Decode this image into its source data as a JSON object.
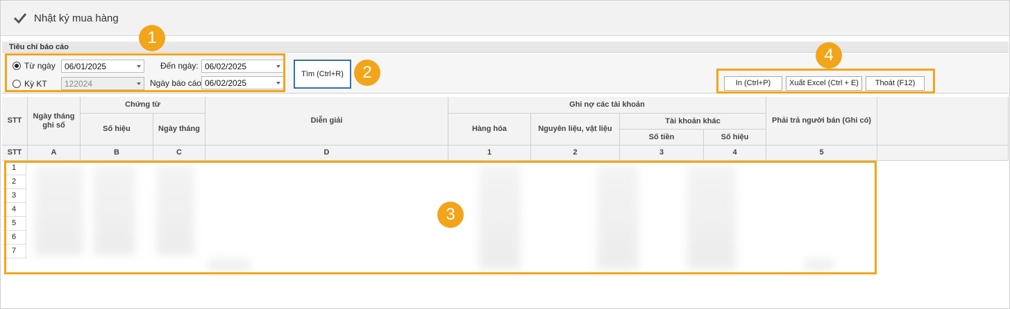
{
  "window": {
    "title": "Nhật ký mua hàng"
  },
  "criteria": {
    "section_title": "Tiêu chí báo cáo",
    "from_date": {
      "label": "Từ ngày",
      "value": "06/01/2025",
      "selected": true
    },
    "period": {
      "label": "Kỳ KT",
      "value": "122024",
      "selected": false
    },
    "to_date": {
      "label": "Đến ngày:",
      "value": "06/02/2025"
    },
    "report_date": {
      "label": "Ngày báo cáo:",
      "value": "06/02/2025"
    }
  },
  "buttons": {
    "search": "Tìm  (Ctrl+R)",
    "print": "In  (Ctrl+P)",
    "export": "Xuất Excel  (Ctrl + E)",
    "exit": "Thoát  (F12)"
  },
  "callouts": [
    "1",
    "2",
    "3",
    "4"
  ],
  "grid": {
    "headers": {
      "stt": "STT",
      "date_recorded": "Ngày tháng ghi sổ",
      "voucher": "Chứng từ",
      "voucher_number": "Số hiệu",
      "voucher_date": "Ngày tháng",
      "description": "Diễn giải",
      "debit_accounts": "Ghi nợ các tài khoản",
      "goods": "Hàng hóa",
      "materials": "Nguyên liệu, vật liệu",
      "other_accounts": "Tài khoản khác",
      "amount": "Số tiền",
      "account_number": "Số hiệu",
      "payable": "Phải trả người bán (Ghi có)"
    },
    "codes": [
      "STT",
      "A",
      "B",
      "C",
      "D",
      "1",
      "2",
      "3",
      "4",
      "5"
    ],
    "rows": [
      "1",
      "2",
      "3",
      "4",
      "5",
      "6",
      "7"
    ]
  },
  "colors": {
    "accent_orange": "#f2a51a",
    "focus_blue": "#2f6fb3"
  }
}
